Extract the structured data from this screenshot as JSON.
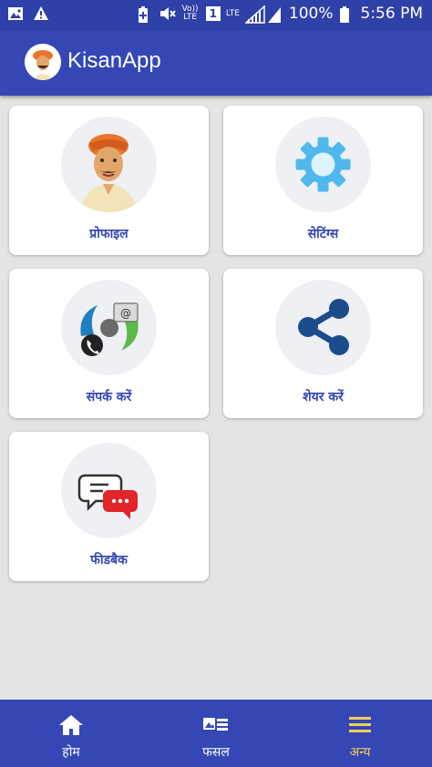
{
  "status_bar": {
    "battery": "100%",
    "time": "5:56 PM",
    "volte": "Vo)) LTE",
    "sim": "1",
    "lte": "LTE"
  },
  "app": {
    "title": "KisanApp"
  },
  "cards": [
    {
      "label": "प्रोफाइल",
      "icon": "farmer-avatar-icon"
    },
    {
      "label": "सेटिंग्स",
      "icon": "gear-icon"
    },
    {
      "label": "संपर्क करें",
      "icon": "contact-icon"
    },
    {
      "label": "शेयर करें",
      "icon": "share-icon"
    },
    {
      "label": "फीडबैक",
      "icon": "chat-bubbles-icon"
    }
  ],
  "bottom_nav": [
    {
      "label": "होम",
      "icon": "home-icon"
    },
    {
      "label": "फसल",
      "icon": "crop-list-icon"
    },
    {
      "label": "अन्य",
      "icon": "menu-icon",
      "active": true
    }
  ],
  "colors": {
    "primary": "#3447b4",
    "status_bar": "#2f40a8",
    "active_nav": "#f0cd5a",
    "background": "#e4e5e3"
  }
}
